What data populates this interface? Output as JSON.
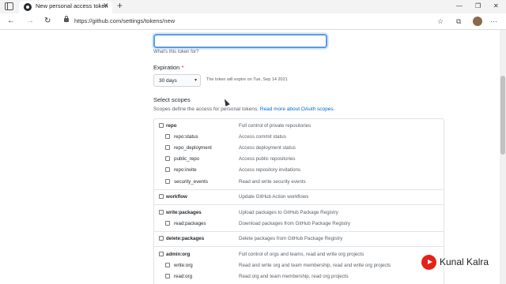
{
  "browser": {
    "tab_title": "New personal access token",
    "tab_close": "✕",
    "new_tab": "+",
    "url": "https://github.com/settings/tokens/new",
    "controls": {
      "minimize": "—",
      "maximize": "❐",
      "close": "✕"
    },
    "nav": {
      "back": "←",
      "forward": "→",
      "refresh": "↻"
    },
    "icons": {
      "favorites": "☆",
      "collections": "⧉",
      "menu": "⋯"
    }
  },
  "note": {
    "value": "",
    "hint": "What's this token for?"
  },
  "expiration": {
    "label": "Expiration",
    "required_mark": "*",
    "selected": "30 days",
    "expiry_note": "The token will expire on Tue, Sep 14 2021"
  },
  "scopes": {
    "title": "Select scopes",
    "description": "Scopes define the access for personal tokens.",
    "link_text": "Read more about OAuth scopes.",
    "groups": [
      {
        "name": "repo",
        "description": "Full control of private repositories",
        "children": [
          {
            "name": "repo:status",
            "description": "Access commit status"
          },
          {
            "name": "repo_deployment",
            "description": "Access deployment status"
          },
          {
            "name": "public_repo",
            "description": "Access public repositories"
          },
          {
            "name": "repo:invite",
            "description": "Access repository invitations"
          },
          {
            "name": "security_events",
            "description": "Read and write security events"
          }
        ]
      },
      {
        "name": "workflow",
        "description": "Update GitHub Action workflows",
        "children": []
      },
      {
        "name": "write:packages",
        "description": "Upload packages to GitHub Package Registry",
        "children": [
          {
            "name": "read:packages",
            "description": "Download packages from GitHub Package Registry"
          }
        ]
      },
      {
        "name": "delete:packages",
        "description": "Delete packages from GitHub Package Registry",
        "children": []
      },
      {
        "name": "admin:org",
        "description": "Full control of orgs and teams, read and write org projects",
        "children": [
          {
            "name": "write:org",
            "description": "Read and write org and team membership, read and write org projects"
          },
          {
            "name": "read:org",
            "description": "Read org and team membership, read org projects"
          }
        ]
      }
    ]
  },
  "watermark": {
    "text": "Kunal Kalra"
  }
}
